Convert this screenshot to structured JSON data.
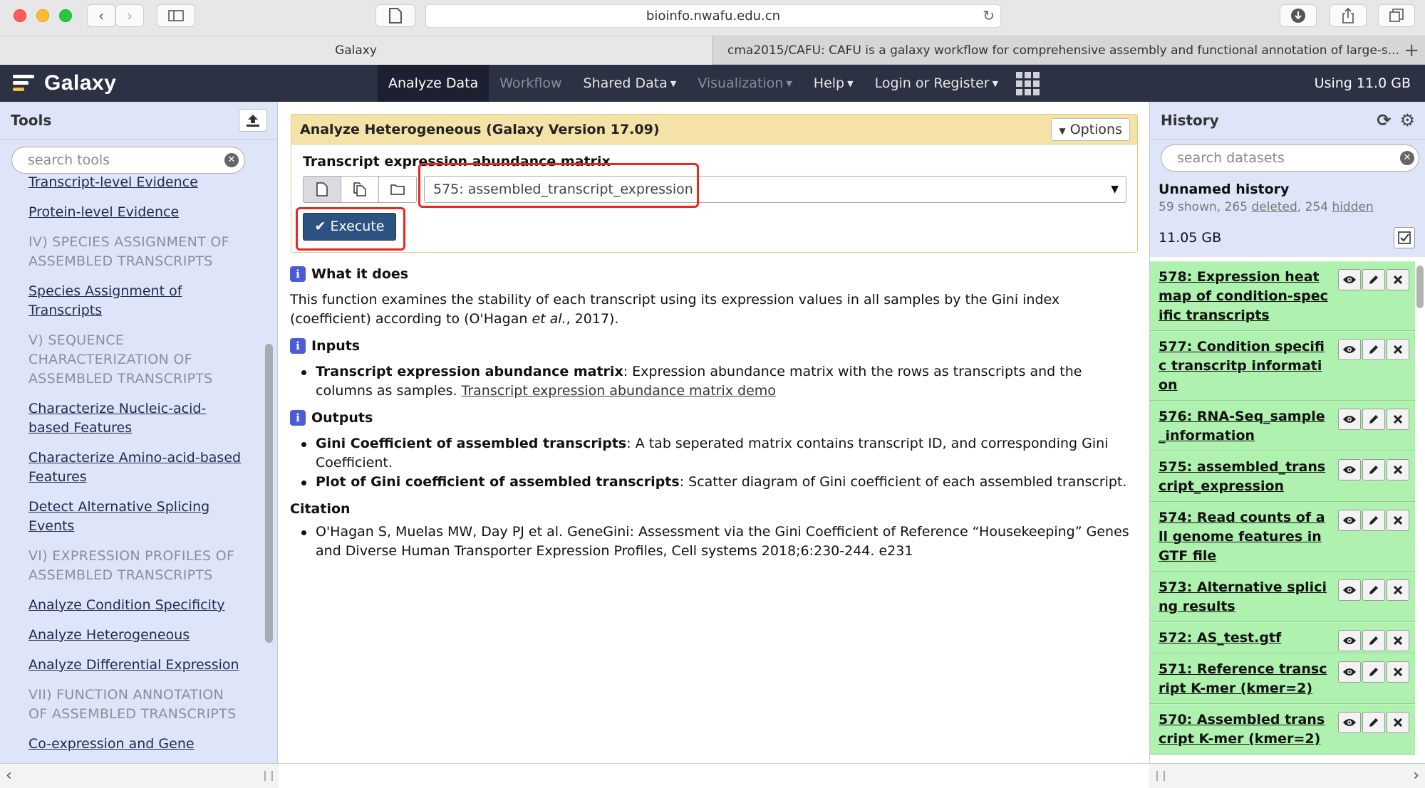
{
  "browser": {
    "url": "bioinfo.nwafu.edu.cn",
    "tabs": [
      {
        "label": "Galaxy"
      },
      {
        "label": "cma2015/CAFU: CAFU is a galaxy workflow for comprehensive assembly and functional annotation of large-s..."
      }
    ]
  },
  "masthead": {
    "brand": "Galaxy",
    "nav": {
      "analyze": "Analyze Data",
      "workflow": "Workflow",
      "shared": "Shared Data",
      "visualization": "Visualization",
      "help": "Help",
      "login": "Login or Register"
    },
    "quota": "Using 11.0 GB"
  },
  "tools_panel": {
    "title": "Tools",
    "search_placeholder": "search tools",
    "items": [
      {
        "kind": "link",
        "label": "Transcript-level Evidence"
      },
      {
        "kind": "link",
        "label": "Protein-level Evidence"
      },
      {
        "kind": "section",
        "label": "IV) SPECIES ASSIGNMENT OF ASSEMBLED TRANSCRIPTS"
      },
      {
        "kind": "link",
        "label": "Species Assignment of Transcripts"
      },
      {
        "kind": "section",
        "label": "V) SEQUENCE CHARACTERIZATION OF ASSEMBLED TRANSCRIPTS"
      },
      {
        "kind": "link",
        "label": "Characterize Nucleic-acid-based Features"
      },
      {
        "kind": "link",
        "label": "Characterize Amino-acid-based Features"
      },
      {
        "kind": "link",
        "label": "Detect Alternative Splicing Events"
      },
      {
        "kind": "section",
        "label": "VI) EXPRESSION PROFILES OF ASSEMBLED TRANSCRIPTS"
      },
      {
        "kind": "link",
        "label": "Analyze Condition Specificity"
      },
      {
        "kind": "link",
        "label": "Analyze Heterogeneous"
      },
      {
        "kind": "link",
        "label": "Analyze Differential Expression"
      },
      {
        "kind": "section",
        "label": "VII) FUNCTION ANNOTATION OF ASSEMBLED TRANSCRIPTS"
      },
      {
        "kind": "link",
        "label": "Co-expression and Gene"
      }
    ]
  },
  "tool_form": {
    "title": "Analyze Heterogeneous (Galaxy Version 17.09)",
    "options_label": "Options",
    "field_label": "Transcript expression abundance matrix",
    "selected_value": "575: assembled_transcript_expression",
    "execute_label": "Execute"
  },
  "help": {
    "what_heading": "What it does",
    "what_text_1": "This function examines the stability of each transcript using its expression values in all samples by the Gini index (coefficient) according to (O'Hagan ",
    "what_text_em": "et al.",
    "what_text_2": ", 2017).",
    "inputs_heading": "Inputs",
    "input_bold": "Transcript expression abundance matrix",
    "input_text": ": Expression abundance matrix with the rows as transcripts and the columns as samples. ",
    "input_link": "Transcript expression abundance matrix demo",
    "outputs_heading": "Outputs",
    "output1_bold": "Gini Coefficient of assembled transcripts",
    "output1_text": ": A tab seperated matrix contains transcript ID, and corresponding Gini Coefficient.",
    "output2_bold": "Plot of Gini coefficient of assembled transcripts",
    "output2_text": ": Scatter diagram of Gini coefficient of each assembled transcript.",
    "citation_heading": "Citation",
    "citation_text": "O'Hagan S, Muelas MW, Day PJ et al. GeneGini: Assessment via the Gini Coefficient of Reference “Housekeeping” Genes and Diverse Human Transporter Expression Profiles, Cell systems 2018;6:230-244. e231"
  },
  "history": {
    "title": "History",
    "search_placeholder": "search datasets",
    "name": "Unnamed history",
    "counts_prefix": "59 shown, 265 ",
    "deleted_label": "deleted",
    "counts_mid": ", 254 ",
    "hidden_label": "hidden",
    "size": "11.05 GB",
    "datasets": [
      {
        "title": "578: Expression heat map of condition-specific transcripts"
      },
      {
        "title": "577: Condition specific transcritp information"
      },
      {
        "title": "576: RNA-Seq_sample_information"
      },
      {
        "title": "575: assembled_transcript_expression"
      },
      {
        "title": "574: Read counts of all genome features in GTF file"
      },
      {
        "title": "573: Alternative splicing results"
      },
      {
        "title": "572: AS_test.gtf"
      },
      {
        "title": "571: Reference transcript K-mer (kmer=2)"
      },
      {
        "title": "570: Assembled transcript K-mer (kmer=2)"
      }
    ]
  }
}
